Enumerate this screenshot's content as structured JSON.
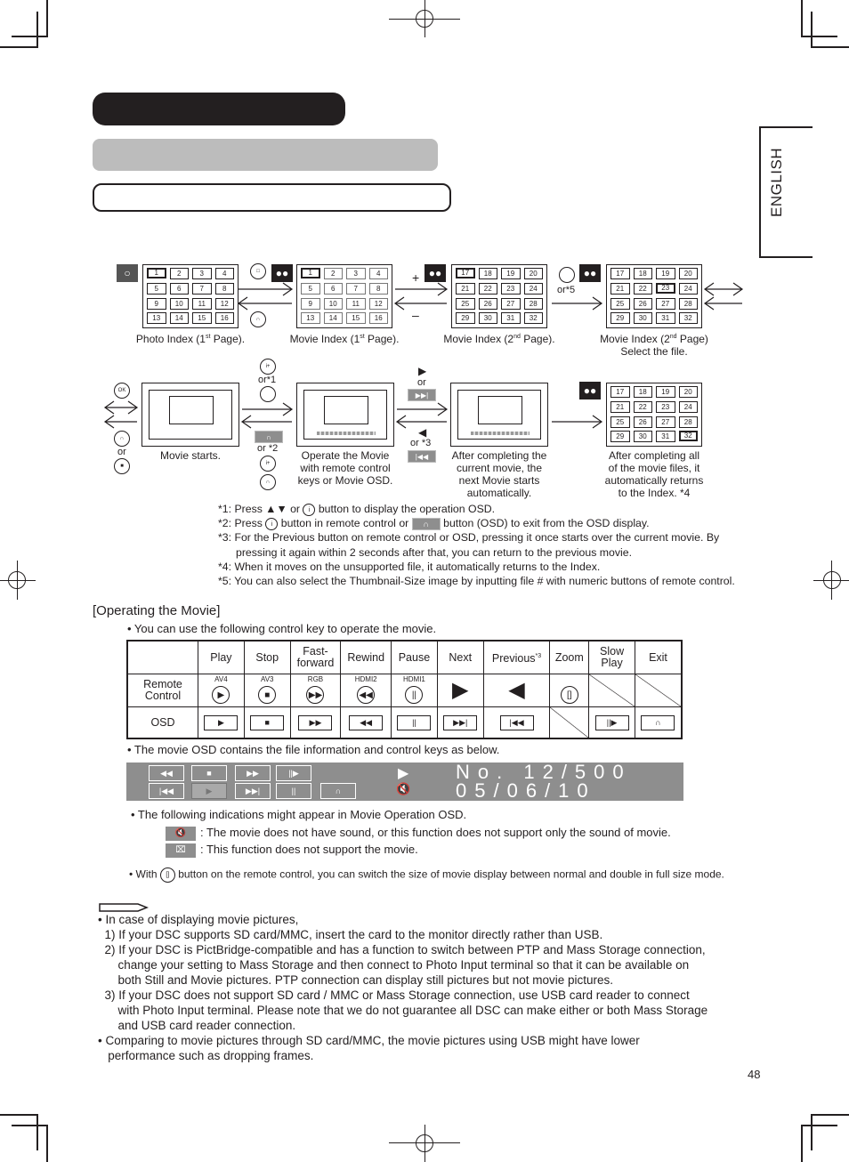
{
  "side_tab": {
    "label": "ENGLISH"
  },
  "flow_row1": {
    "grids": [
      {
        "name": "photo-index-page1",
        "cells": [
          "1",
          "2",
          "3",
          "4",
          "5",
          "6",
          "7",
          "8",
          "9",
          "10",
          "11",
          "12",
          "13",
          "14",
          "15",
          "16"
        ],
        "selected": "1",
        "caption_pre": "Photo Index (1",
        "caption_sup": "st",
        "caption_post": " Page)."
      },
      {
        "name": "movie-index-page1",
        "cells": [
          "1",
          "2",
          "3",
          "4",
          "5",
          "6",
          "7",
          "8",
          "9",
          "10",
          "11",
          "12",
          "13",
          "14",
          "15",
          "16"
        ],
        "selected": "1",
        "caption_pre": "Movie Index (1",
        "caption_sup": "st",
        "caption_post": " Page)."
      },
      {
        "name": "movie-index-page2",
        "cells": [
          "17",
          "18",
          "19",
          "20",
          "21",
          "22",
          "23",
          "24",
          "25",
          "26",
          "27",
          "28",
          "29",
          "30",
          "31",
          "32"
        ],
        "selected": "17",
        "caption_pre": "Movie Index (2",
        "caption_sup": "nd",
        "caption_post": " Page)."
      },
      {
        "name": "movie-index-page2-select",
        "cells": [
          "17",
          "18",
          "19",
          "20",
          "21",
          "22",
          "23",
          "24",
          "25",
          "26",
          "27",
          "28",
          "29",
          "30",
          "31",
          "32"
        ],
        "selected": "23",
        "caption_pre": "Movie Index (2",
        "caption_sup": "nd",
        "caption_post": " Page)",
        "caption_line2": "Select the file."
      }
    ],
    "plus": "+",
    "minus": "–",
    "or5": "or*5"
  },
  "flow_row2": {
    "ok_label": "OK",
    "or": "or",
    "or1": "or*1",
    "or2": "or *2",
    "or3": "or *3",
    "captions": {
      "movie_starts": "Movie starts.",
      "operate": [
        "Operate the Movie",
        "with remote control",
        "keys or Movie OSD."
      ],
      "after_current": [
        "After completing the",
        "current movie, the",
        "next Movie starts",
        "automatically."
      ],
      "after_all": [
        "After completing all",
        "of the movie files, it",
        "automatically returns",
        "to the Index. *4"
      ]
    },
    "end_grid": {
      "cells": [
        "17",
        "18",
        "19",
        "20",
        "21",
        "22",
        "23",
        "24",
        "25",
        "26",
        "27",
        "28",
        "29",
        "30",
        "31",
        "32"
      ],
      "selected": "32"
    }
  },
  "footnotes": {
    "n1_a": "*1: Press ▲▼ or ",
    "n1_b": " button to display the operation OSD.",
    "n2_a": "*2: Press ",
    "n2_b": " button in remote control or ",
    "n2_c": " button (OSD) to exit from the OSD display.",
    "n3_l1": "*3: For the Previous button on remote control or OSD, pressing it once starts over the current movie. By",
    "n3_l2": "pressing it again within 2 seconds after that, you can return to the previous movie.",
    "n4": "*4: When it moves on the unsupported file, it automatically returns to the Index.",
    "n5": "*5: You can also select the Thumbnail-Size image by inputting file # with numeric buttons of remote control."
  },
  "operating": {
    "title": "[Operating the Movie]",
    "intro": "• You can use the following control key to operate the movie.",
    "table": {
      "columns": [
        "Play",
        "Stop",
        "Fast-\nforward",
        "Rewind",
        "Pause",
        "Next",
        "Previous",
        "Zoom",
        "Slow\nPlay",
        "Exit"
      ],
      "previous_note": "*3",
      "row_labels": {
        "remote": "Remote\nControl",
        "osd": "OSD"
      },
      "remote_labels": [
        "AV4",
        "AV3",
        "RGB",
        "HDMI2",
        "HDMI1",
        "",
        "",
        "",
        "",
        ""
      ],
      "remote_icons": [
        "play-circle",
        "stop-circle",
        "fast-forward-circle",
        "rewind-circle",
        "pause-circle",
        "next-triangle",
        "previous-triangle",
        "zoom-circle",
        "none",
        "none"
      ],
      "osd_icons": [
        "play",
        "stop",
        "fast-forward",
        "rewind",
        "pause",
        "next",
        "previous",
        "none",
        "slow-play",
        "exit"
      ]
    },
    "osd_intro": "• The movie OSD contains the file information and control keys as below.",
    "osd_bar": {
      "row1_buttons": [
        "rewind",
        "stop",
        "fast-forward",
        "slow-play"
      ],
      "row2_buttons": [
        "previous",
        "play",
        "next",
        "pause",
        "exit"
      ],
      "active_button": "play",
      "file_no": "No.  12/500",
      "date": "05/06/10"
    },
    "indications_intro": "• The following indications might appear in Movie Operation OSD.",
    "indication_mute": ": The movie does not have sound, or this function does not support only the sound of movie.",
    "indication_unsupported": ": This function does not support the movie.",
    "zoom_note_a": "• With ",
    "zoom_note_b": " button on the remote control, you can switch the size of movie display between normal and double in full size mode."
  },
  "note": {
    "lines": [
      "• In case of displaying movie pictures,",
      "  1) If your DSC supports SD card/MMC, insert the card to the monitor directly rather than USB.",
      "  2) If your DSC is PictBridge-compatible and has a function to switch between PTP and Mass Storage connection,",
      "      change your setting to Mass Storage and then connect to Photo Input terminal so that it can be available on",
      "      both Still and Movie pictures. PTP connection can display still pictures but not movie pictures.",
      "  3) If your DSC does not support SD card / MMC or Mass Storage connection, use USB card reader to connect",
      "      with Photo Input terminal. Please note that we do not guarantee all DSC can make either or both Mass Storage",
      "      and USB card reader connection.",
      "• Comparing to movie pictures through SD card/MMC, the movie pictures using USB might have lower",
      "   performance such as dropping frames."
    ]
  },
  "page_number": "48",
  "colors": {
    "ink": "#231f20",
    "header_gray": "#bcbcbc",
    "osd_gray": "#8e8e8e"
  }
}
